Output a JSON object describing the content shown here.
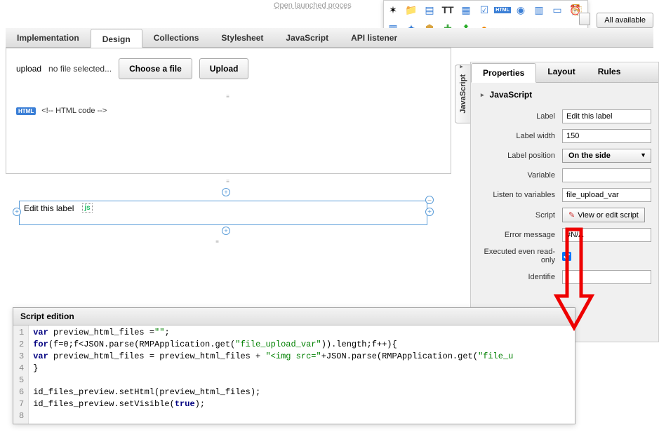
{
  "top_link": "Open launched proces",
  "all_available_btn": "All available",
  "tabs": [
    "Implementation",
    "Design",
    "Collections",
    "Stylesheet",
    "JavaScript",
    "API listener"
  ],
  "active_tab_index": 1,
  "upload": {
    "label": "upload",
    "nofile": "no file selected...",
    "choose": "Choose a file",
    "upload_btn": "Upload"
  },
  "html_comment": "<!-- HTML code -->",
  "html_badge": "HTML",
  "selected_widget": {
    "label": "Edit this label",
    "badge": "js"
  },
  "vert_tab": "JavaScript",
  "props": {
    "tabs": [
      "Properties",
      "Layout",
      "Rules"
    ],
    "active_index": 0,
    "header": "JavaScript",
    "label": {
      "label": "Label",
      "value": "Edit this label"
    },
    "label_width": {
      "label": "Label width",
      "value": "150"
    },
    "label_position": {
      "label": "Label position",
      "value": "On the side"
    },
    "variable": {
      "label": "Variable",
      "value": ""
    },
    "listen": {
      "label": "Listen to variables",
      "value": "file_upload_var"
    },
    "script": {
      "label": "Script",
      "btn": "View or edit script"
    },
    "error_msg": {
      "label": "Error message",
      "value": "#N/A"
    },
    "exec_readonly": {
      "label": "Executed even read-only",
      "checked": true
    },
    "identifier": {
      "label": "Identifie",
      "value": ""
    }
  },
  "script_editor": {
    "title": "Script edition",
    "lines": [
      {
        "n": 1,
        "k1": "var",
        "t1": " preview_html_files =",
        "s1": "\"\"",
        "t2": ";"
      },
      {
        "n": 2,
        "k1": "for",
        "t1": "(f=0;f<JSON.parse(RMPApplication.get(",
        "s1": "\"file_upload_var\"",
        "t2": ")).length;f++){"
      },
      {
        "n": 3,
        "k1": "var",
        "t1": " preview_html_files = preview_html_files + ",
        "s1": "\"<img src=\"",
        "t2": "+JSON.parse(RMPApplication.get(",
        "s2": "\"file_u"
      },
      {
        "n": 4,
        "t1": "}"
      },
      {
        "n": 5,
        "t1": ""
      },
      {
        "n": 6,
        "t1": "id_files_preview.setHtml(preview_html_files);"
      },
      {
        "n": 7,
        "t1": "id_files_preview.setVisible(",
        "k1": "true",
        "t2": ");"
      },
      {
        "n": 8,
        "t1": ""
      }
    ]
  },
  "palette_icons": [
    "loading",
    "folder",
    "list",
    "text-tt",
    "form",
    "checkbox",
    "html",
    "radio",
    "calendar",
    "page",
    "clock",
    "grid",
    "wand",
    "shield",
    "puzzle",
    "tree",
    "pin",
    "copy"
  ]
}
